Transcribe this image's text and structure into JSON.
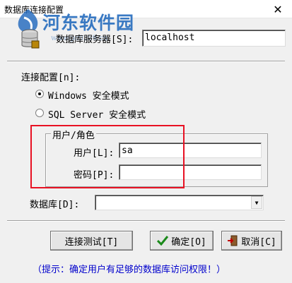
{
  "window": {
    "title": "数据库连接配置",
    "close_glyph": "✕"
  },
  "watermark": {
    "text": "河东软件园",
    "url": "www.pc0359.cn"
  },
  "server": {
    "label": "数据库服务器[S]:",
    "value": "localhost"
  },
  "connection": {
    "label": "连接配置[n]:",
    "options": [
      {
        "label": "Windows 安全模式",
        "checked": true
      },
      {
        "label": "SQL Server 安全模式",
        "checked": false
      }
    ]
  },
  "user_group": {
    "legend": "用户/角色",
    "user_label": "用户[L]:",
    "user_value": "sa",
    "password_label": "密码[P]:",
    "password_value": ""
  },
  "database": {
    "label": "数据库[D]:",
    "value": ""
  },
  "buttons": {
    "test": "连接测试[T]",
    "ok": "确定[O]",
    "cancel": "取消[C]"
  },
  "hint": "（提示：确定用户有足够的数据库访问权限！）",
  "colors": {
    "highlight_box": "#e81123",
    "hint_text": "#0000cc",
    "watermark": "#2a6fbf"
  },
  "icons": {
    "ok": "checkmark-icon",
    "cancel": "exit-door-icon",
    "database": "database-icon"
  }
}
